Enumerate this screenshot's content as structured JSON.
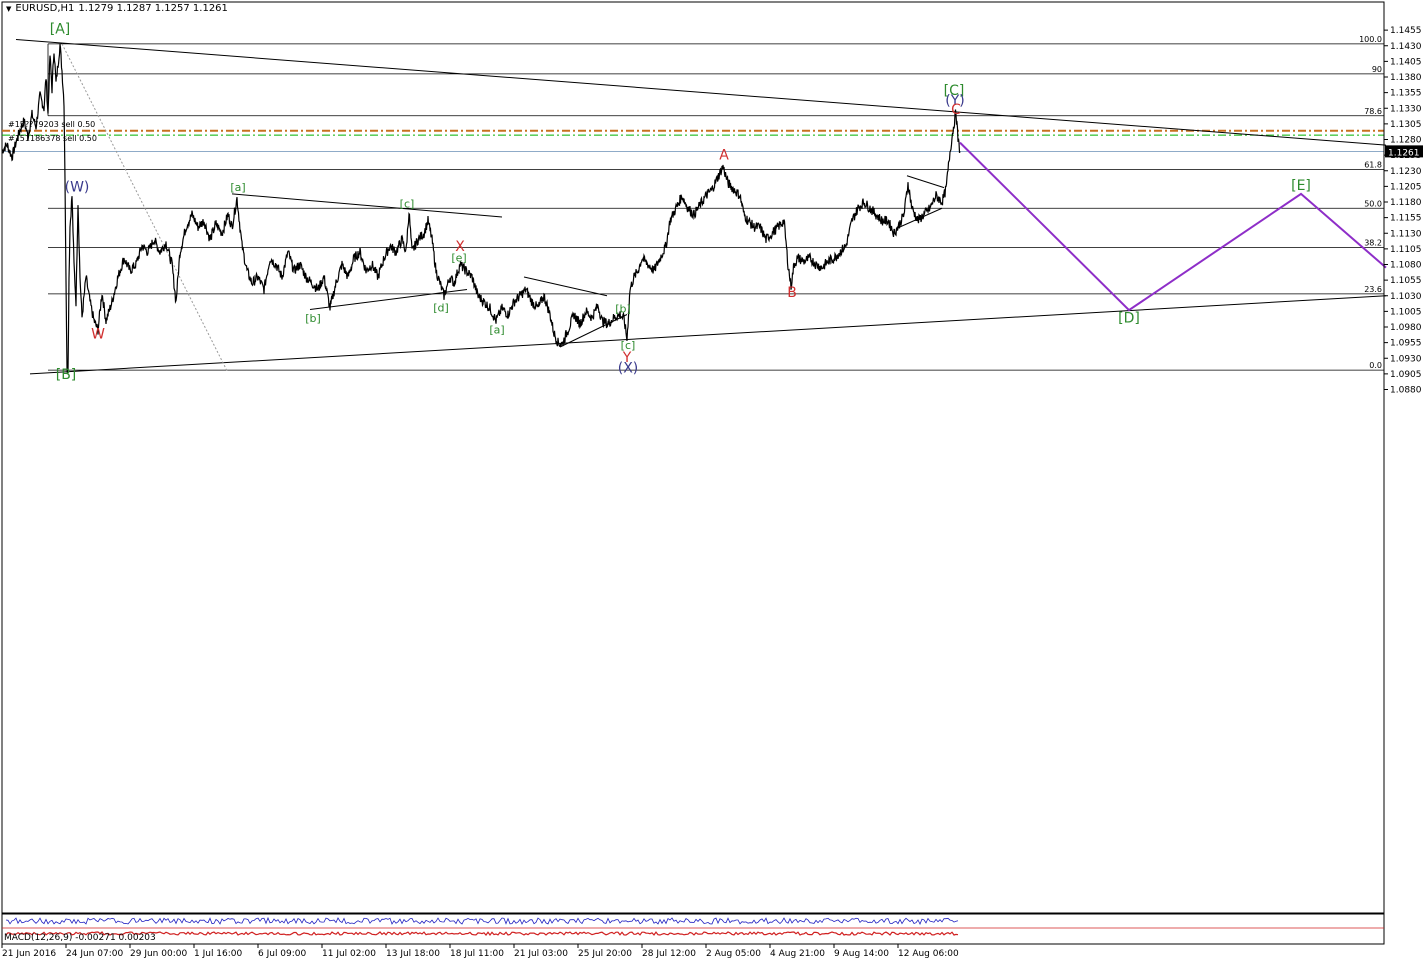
{
  "header": {
    "symbol": "EURUSD,H1",
    "ohlc": "1.1279 1.1287 1.1257 1.1261"
  },
  "macd_label": "MACD(12,26,9) -0.00271 0.00203",
  "orders": [
    "#15??79203 sell 0.50",
    "#151186378 sell 0.50"
  ],
  "current_price_label": "1.1261",
  "chart_data": {
    "type": "line",
    "symbol": "EURUSD",
    "timeframe": "H1",
    "ylim": [
      1.0892,
      1.1468
    ],
    "price_ticks": [
      1.088,
      1.0905,
      1.093,
      1.0955,
      1.098,
      1.1005,
      1.103,
      1.1055,
      1.108,
      1.1105,
      1.113,
      1.1155,
      1.118,
      1.1205,
      1.123,
      1.1255,
      1.128,
      1.1305,
      1.133,
      1.1355,
      1.138,
      1.1405,
      1.143,
      1.1455
    ],
    "x_ticks": [
      "21 Jun 2016",
      "24 Jun 07:00",
      "29 Jun 00:00",
      "1 Jul 16:00",
      "6 Jul 09:00",
      "11 Jul 02:00",
      "13 Jul 18:00",
      "18 Jul 11:00",
      "21 Jul 03:00",
      "25 Jul 20:00",
      "28 Jul 12:00",
      "2 Aug 05:00",
      "4 Aug 21:00",
      "9 Aug 14:00",
      "12 Aug 06:00"
    ],
    "x_tick_pos": [
      0,
      64,
      128,
      192,
      256,
      320,
      384,
      448,
      512,
      576,
      640,
      704,
      768,
      832,
      896
    ],
    "x_range": [
      0,
      1384
    ],
    "price_path": [
      [
        0,
        1.1262
      ],
      [
        5,
        1.1272
      ],
      [
        10,
        1.1252
      ],
      [
        14,
        1.1275
      ],
      [
        18,
        1.1295
      ],
      [
        22,
        1.131
      ],
      [
        26,
        1.1285
      ],
      [
        30,
        1.132
      ],
      [
        34,
        1.13
      ],
      [
        38,
        1.135
      ],
      [
        42,
        1.133
      ],
      [
        44,
        1.138
      ],
      [
        46,
        1.132
      ],
      [
        48,
        1.1415
      ],
      [
        50,
        1.136
      ],
      [
        52,
        1.1425
      ],
      [
        54,
        1.137
      ],
      [
        56,
        1.14
      ],
      [
        58,
        1.1432
      ],
      [
        60,
        1.139
      ],
      [
        62,
        1.134
      ],
      [
        63,
        1.122
      ],
      [
        64,
        1.105
      ],
      [
        65,
        1.092
      ],
      [
        66,
        1.0905
      ],
      [
        67,
        1.106
      ],
      [
        68,
        1.114
      ],
      [
        70,
        1.119
      ],
      [
        72,
        1.108
      ],
      [
        74,
        1.102
      ],
      [
        76,
        1.118
      ],
      [
        78,
        1.106
      ],
      [
        80,
        1.0995
      ],
      [
        84,
        1.106
      ],
      [
        88,
        1.102
      ],
      [
        92,
        1.099
      ],
      [
        96,
        1.0975
      ],
      [
        100,
        1.1035
      ],
      [
        104,
        1.099
      ],
      [
        110,
        1.102
      ],
      [
        116,
        1.106
      ],
      [
        122,
        1.109
      ],
      [
        128,
        1.107
      ],
      [
        134,
        1.108
      ],
      [
        140,
        1.111
      ],
      [
        146,
        1.11
      ],
      [
        152,
        1.112
      ],
      [
        158,
        1.11
      ],
      [
        164,
        1.1115
      ],
      [
        170,
        1.108
      ],
      [
        174,
        1.102
      ],
      [
        178,
        1.11
      ],
      [
        184,
        1.114
      ],
      [
        190,
        1.116
      ],
      [
        196,
        1.114
      ],
      [
        202,
        1.115
      ],
      [
        208,
        1.112
      ],
      [
        214,
        1.1145
      ],
      [
        220,
        1.113
      ],
      [
        226,
        1.116
      ],
      [
        230,
        1.114
      ],
      [
        235,
        1.1186
      ],
      [
        240,
        1.111
      ],
      [
        245,
        1.107
      ],
      [
        250,
        1.105
      ],
      [
        256,
        1.106
      ],
      [
        262,
        1.104
      ],
      [
        268,
        1.109
      ],
      [
        274,
        1.108
      ],
      [
        280,
        1.106
      ],
      [
        286,
        1.11
      ],
      [
        292,
        1.107
      ],
      [
        298,
        1.108
      ],
      [
        304,
        1.106
      ],
      [
        310,
        1.105
      ],
      [
        316,
        1.104
      ],
      [
        322,
        1.106
      ],
      [
        328,
        1.101
      ],
      [
        334,
        1.105
      ],
      [
        340,
        1.108
      ],
      [
        346,
        1.106
      ],
      [
        352,
        1.109
      ],
      [
        358,
        1.11
      ],
      [
        364,
        1.107
      ],
      [
        370,
        1.108
      ],
      [
        376,
        1.106
      ],
      [
        382,
        1.109
      ],
      [
        388,
        1.111
      ],
      [
        394,
        1.11
      ],
      [
        400,
        1.112
      ],
      [
        404,
        1.11
      ],
      [
        407,
        1.1165
      ],
      [
        410,
        1.11
      ],
      [
        416,
        1.112
      ],
      [
        422,
        1.113
      ],
      [
        426,
        1.115
      ],
      [
        430,
        1.112
      ],
      [
        434,
        1.107
      ],
      [
        438,
        1.105
      ],
      [
        442,
        1.103
      ],
      [
        448,
        1.106
      ],
      [
        452,
        1.105
      ],
      [
        458,
        1.108
      ],
      [
        464,
        1.107
      ],
      [
        470,
        1.106
      ],
      [
        476,
        1.103
      ],
      [
        482,
        1.102
      ],
      [
        488,
        1.101
      ],
      [
        494,
        1.099
      ],
      [
        500,
        1.101
      ],
      [
        506,
        1.1
      ],
      [
        512,
        1.102
      ],
      [
        518,
        1.103
      ],
      [
        524,
        1.104
      ],
      [
        530,
        1.102
      ],
      [
        536,
        1.101
      ],
      [
        542,
        1.103
      ],
      [
        548,
        1.1
      ],
      [
        552,
        1.097
      ],
      [
        556,
        1.0955
      ],
      [
        560,
        1.0952
      ],
      [
        566,
        1.0975
      ],
      [
        572,
        1.1
      ],
      [
        578,
        1.0985
      ],
      [
        584,
        1.1005
      ],
      [
        590,
        1.0995
      ],
      [
        596,
        1.1015
      ],
      [
        600,
        1.099
      ],
      [
        606,
        1.0985
      ],
      [
        612,
        1.0995
      ],
      [
        618,
        1.1
      ],
      [
        622,
        1.0993
      ],
      [
        625,
        1.096
      ],
      [
        628,
        1.104
      ],
      [
        632,
        1.106
      ],
      [
        636,
        1.107
      ],
      [
        640,
        1.109
      ],
      [
        646,
        1.108
      ],
      [
        652,
        1.107
      ],
      [
        658,
        1.109
      ],
      [
        664,
        1.111
      ],
      [
        668,
        1.115
      ],
      [
        674,
        1.117
      ],
      [
        680,
        1.119
      ],
      [
        686,
        1.117
      ],
      [
        692,
        1.116
      ],
      [
        698,
        1.1175
      ],
      [
        704,
        1.119
      ],
      [
        710,
        1.12
      ],
      [
        716,
        1.122
      ],
      [
        721,
        1.1237
      ],
      [
        726,
        1.121
      ],
      [
        732,
        1.12
      ],
      [
        738,
        1.119
      ],
      [
        742,
        1.116
      ],
      [
        746,
        1.115
      ],
      [
        752,
        1.114
      ],
      [
        758,
        1.114
      ],
      [
        764,
        1.112
      ],
      [
        770,
        1.113
      ],
      [
        776,
        1.114
      ],
      [
        782,
        1.115
      ],
      [
        786,
        1.108
      ],
      [
        789,
        1.1045
      ],
      [
        792,
        1.108
      ],
      [
        796,
        1.109
      ],
      [
        802,
        1.1085
      ],
      [
        808,
        1.109
      ],
      [
        814,
        1.108
      ],
      [
        820,
        1.1075
      ],
      [
        826,
        1.1085
      ],
      [
        832,
        1.109
      ],
      [
        838,
        1.11
      ],
      [
        844,
        1.111
      ],
      [
        850,
        1.115
      ],
      [
        856,
        1.117
      ],
      [
        862,
        1.118
      ],
      [
        868,
        1.117
      ],
      [
        874,
        1.116
      ],
      [
        880,
        1.115
      ],
      [
        886,
        1.115
      ],
      [
        892,
        1.113
      ],
      [
        896,
        1.114
      ],
      [
        902,
        1.116
      ],
      [
        906,
        1.121
      ],
      [
        910,
        1.117
      ],
      [
        916,
        1.115
      ],
      [
        922,
        1.116
      ],
      [
        928,
        1.117
      ],
      [
        934,
        1.119
      ],
      [
        940,
        1.118
      ],
      [
        944,
        1.12
      ],
      [
        948,
        1.126
      ],
      [
        951,
        1.1295
      ],
      [
        954,
        1.1325
      ],
      [
        956,
        1.128
      ],
      [
        958,
        1.1261
      ]
    ],
    "projection": [
      [
        958,
        1.1275
      ],
      [
        1127,
        1.1007
      ],
      [
        1299,
        1.1193
      ],
      [
        1384,
        1.1075
      ]
    ],
    "hlines": [
      {
        "price": 1.1433,
        "label": "100.0"
      },
      {
        "price": 1.1385,
        "label": "90"
      },
      {
        "price": 1.1318,
        "label": "78.6"
      },
      {
        "price": 1.1232,
        "label": "61.8"
      },
      {
        "price": 1.117,
        "label": "50.0"
      },
      {
        "price": 1.1107,
        "label": "38.2"
      },
      {
        "price": 1.1033,
        "label": "23.6"
      },
      {
        "price": 1.0911,
        "label": "0.0"
      }
    ],
    "order_lines": [
      {
        "price": 1.1294,
        "color": "#c87020",
        "style": "dashdot"
      },
      {
        "price": 1.1287,
        "color": "#00b000",
        "style": "dashdot"
      }
    ],
    "bid_price": 1.1261,
    "trendlines": [
      [
        [
          14,
          1.144
        ],
        [
          1384,
          1.1271
        ]
      ],
      [
        [
          28,
          1.0905
        ],
        [
          1384,
          1.103
        ]
      ],
      [
        [
          230,
          1.1193
        ],
        [
          500,
          1.1156
        ]
      ],
      [
        [
          308,
          1.1008
        ],
        [
          465,
          1.104
        ]
      ],
      [
        [
          522,
          1.106
        ],
        [
          605,
          1.103
        ]
      ],
      [
        [
          558,
          1.0948
        ],
        [
          625,
          1.1
        ]
      ],
      [
        [
          905,
          1.1222
        ],
        [
          942,
          1.1203
        ]
      ],
      [
        [
          895,
          1.1138
        ],
        [
          940,
          1.117
        ]
      ]
    ],
    "dotted_line": [
      [
        60,
        1.1433
      ],
      [
        225,
        1.091
      ]
    ],
    "wave_labels": [
      {
        "text": "[A]",
        "x": 58,
        "price": 1.145,
        "color": "#2e8b2e",
        "size": 14
      },
      {
        "text": "[B]",
        "x": 64,
        "price": 1.0897,
        "color": "#2e8b2e",
        "size": 14
      },
      {
        "text": "(W)",
        "x": 75,
        "price": 1.1197,
        "color": "#3a3a8c",
        "size": 14
      },
      {
        "text": "W",
        "x": 96,
        "price": 1.0962,
        "color": "#d03030",
        "size": 14
      },
      {
        "text": "[a]",
        "x": 236,
        "price": 1.1198,
        "color": "#2e8b2e",
        "size": 11
      },
      {
        "text": "[b]",
        "x": 311,
        "price": 1.0988,
        "color": "#2e8b2e",
        "size": 11
      },
      {
        "text": "[c]",
        "x": 405,
        "price": 1.1171,
        "color": "#2e8b2e",
        "size": 11
      },
      {
        "text": "[d]",
        "x": 439,
        "price": 1.1005,
        "color": "#2e8b2e",
        "size": 11
      },
      {
        "text": "X",
        "x": 458,
        "price": 1.1102,
        "color": "#d03030",
        "size": 14
      },
      {
        "text": "[e]",
        "x": 457,
        "price": 1.1085,
        "color": "#2e8b2e",
        "size": 11
      },
      {
        "text": "[a]",
        "x": 495,
        "price": 1.097,
        "color": "#2e8b2e",
        "size": 11
      },
      {
        "text": "[b]",
        "x": 621,
        "price": 1.1003,
        "color": "#2e8b2e",
        "size": 11
      },
      {
        "text": "[c]",
        "x": 626,
        "price": 1.0945,
        "color": "#2e8b2e",
        "size": 11
      },
      {
        "text": "Y",
        "x": 625,
        "price": 1.0924,
        "color": "#d03030",
        "size": 14
      },
      {
        "text": "(X)",
        "x": 626,
        "price": 1.0907,
        "color": "#3a3a8c",
        "size": 14
      },
      {
        "text": "A",
        "x": 722,
        "price": 1.1248,
        "color": "#d03030",
        "size": 14
      },
      {
        "text": "B",
        "x": 790,
        "price": 1.1028,
        "color": "#d03030",
        "size": 14
      },
      {
        "text": "[C]",
        "x": 952,
        "price": 1.1351,
        "color": "#2e8b2e",
        "size": 14
      },
      {
        "text": "(Y)",
        "x": 953,
        "price": 1.1335,
        "color": "#3a3a8c",
        "size": 14
      },
      {
        "text": "C",
        "x": 954,
        "price": 1.1321,
        "color": "#d03030",
        "size": 14
      },
      {
        "text": "[D]",
        "x": 1127,
        "price": 1.0987,
        "color": "#2e8b2e",
        "size": 14
      },
      {
        "text": "[E]",
        "x": 1299,
        "price": 1.1199,
        "color": "#2e8b2e",
        "size": 14
      }
    ]
  },
  "colors": {
    "price": "#000000",
    "projection": "#8e2ec8",
    "fib": "#000000",
    "bid": "#6a8fb5",
    "border": "#000000",
    "indicator": "#2020c0",
    "indicator_red": "#d02020"
  }
}
